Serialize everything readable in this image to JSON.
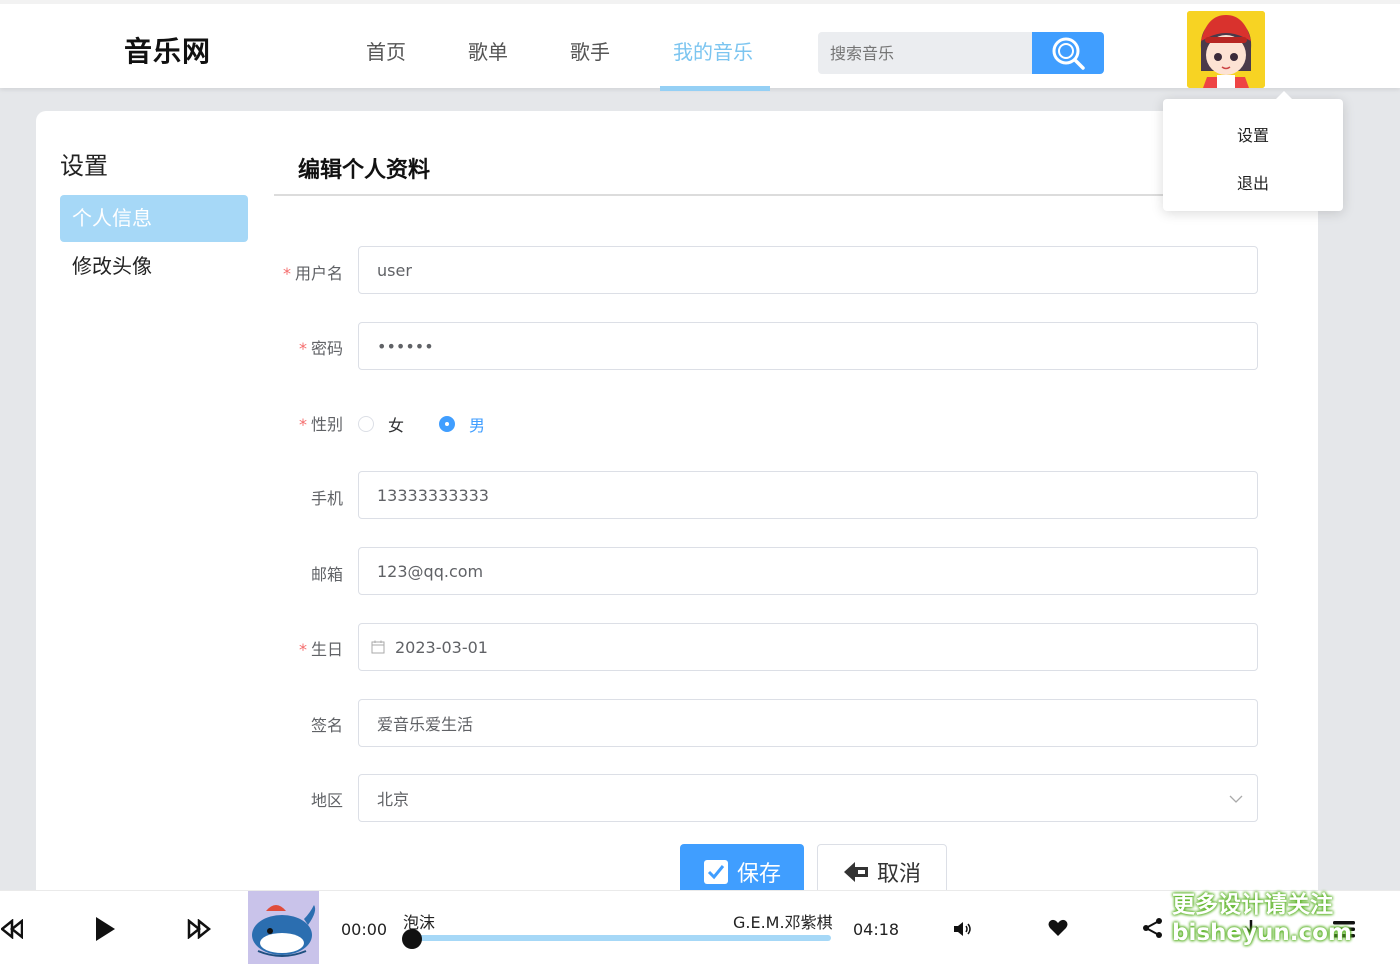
{
  "header": {
    "logo": "音乐网",
    "nav": [
      "首页",
      "歌单",
      "歌手",
      "我的音乐"
    ],
    "active_nav": "我的音乐",
    "search_placeholder": "搜索音乐"
  },
  "dropdown": {
    "items": [
      "设置",
      "退出"
    ]
  },
  "sidebar": {
    "title": "设置",
    "items": [
      "个人信息",
      "修改头像"
    ],
    "active": "个人信息"
  },
  "form": {
    "title": "编辑个人资料",
    "username": {
      "label": "用户名",
      "value": "user"
    },
    "password": {
      "label": "密码",
      "value": "••••••"
    },
    "gender": {
      "label": "性别",
      "options": [
        "女",
        "男"
      ],
      "selected": "男"
    },
    "phone": {
      "label": "手机",
      "value": "13333333333"
    },
    "email": {
      "label": "邮箱",
      "value": "123@qq.com"
    },
    "birthday": {
      "label": "生日",
      "value": "2023-03-01"
    },
    "signature": {
      "label": "签名",
      "value": "爱音乐爱生活"
    },
    "region": {
      "label": "地区",
      "value": "北京"
    },
    "save_label": "保存",
    "cancel_label": "取消"
  },
  "player": {
    "current_time": "00:00",
    "song": "泡沫",
    "artist": "G.E.M.邓紫棋",
    "duration": "04:18",
    "progress": 0
  },
  "watermark": {
    "line1": "更多设计请关注",
    "line2": "bisheyun.com"
  },
  "colors": {
    "primary": "#409eff",
    "nav_active": "#7cc5f0",
    "required": "#f56c6c",
    "sidebar_active": "#a6d8f7"
  }
}
